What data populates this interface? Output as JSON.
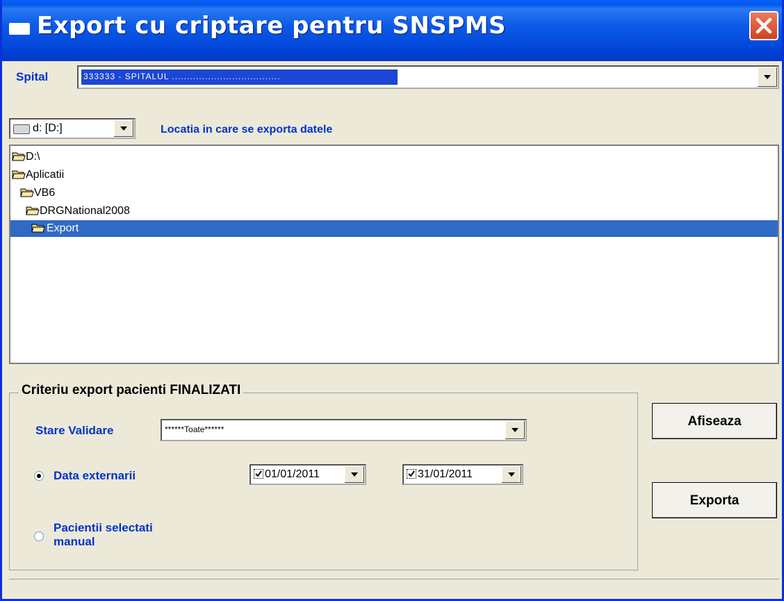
{
  "window": {
    "title": "Export cu criptare pentru SNSPMS"
  },
  "spital": {
    "label": "Spital",
    "selected_value": "333333 - SPITALUL ...................................."
  },
  "location": {
    "drive_value": "d: [D:]",
    "hint": "Locatia in care se exporta datele"
  },
  "tree": {
    "items": [
      {
        "label": "D:\\"
      },
      {
        "label": "Aplicatii"
      },
      {
        "label": "VB6"
      },
      {
        "label": "DRGNational2008"
      },
      {
        "label": "Export"
      }
    ],
    "selected_index": 4
  },
  "criteria": {
    "title": "Criteriu export pacienti FINALIZATI",
    "stare_label": "Stare Validare",
    "stare_value": "******Toate******",
    "data_label": "Data externarii",
    "date_from": "01/01/2011",
    "date_to": "31/01/2011",
    "manual_label_line1": "Pacientii selectati",
    "manual_label_line2": "manual",
    "selected_option": "data_externarii"
  },
  "buttons": {
    "afiseaza": "Afiseaza",
    "exporta": "Exporta"
  },
  "icons": {
    "close": "close-icon",
    "dropdown": "chevron-down-icon",
    "folder": "folder-open-icon",
    "drive": "drive-icon"
  },
  "colors": {
    "titlebar": "#0058ee",
    "accent_label": "#0033cc",
    "selection": "#316ac5",
    "window_bg": "#ece9d8"
  }
}
